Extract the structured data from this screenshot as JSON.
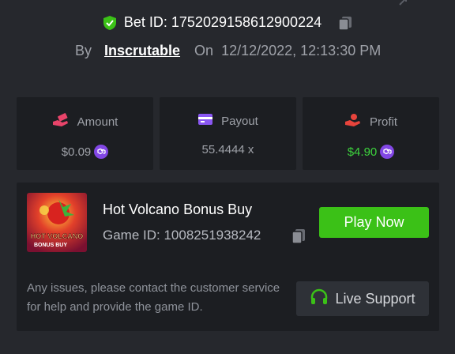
{
  "bet": {
    "id_label": "Bet ID: 1752029158612900224",
    "by_label": "By",
    "username": "Inscrutable",
    "on_label": "On",
    "datetime": "12/12/2022, 12:13:30 PM"
  },
  "stats": {
    "amount": {
      "label": "Amount",
      "value": "$0.09",
      "icon": "hand-money-icon",
      "currency_icon": "polygon-coin-icon"
    },
    "payout": {
      "label": "Payout",
      "value": "55.4444 x",
      "icon": "card-icon"
    },
    "profit": {
      "label": "Profit",
      "value": "$4.90",
      "icon": "hand-coin-icon",
      "currency_icon": "polygon-coin-icon"
    }
  },
  "game": {
    "title": "Hot Volcano Bonus Buy",
    "id_label": "Game ID: 1008251938242",
    "thumb_text_1": "HOT VOLCANO",
    "thumb_text_2": "BONUS BUY",
    "play_label": "Play Now",
    "note": "Any issues, please contact the customer service for help and provide the game ID.",
    "support_label": "Live Support"
  },
  "colors": {
    "background": "#26282d",
    "panel": "#1c1e22",
    "accent_green": "#3bc117",
    "profit_green": "#3dd43d",
    "coin_purple": "#8247e5",
    "amount_icon": "#e8446a",
    "payout_icon": "#8a57f2",
    "profit_icon": "#e8443c"
  }
}
